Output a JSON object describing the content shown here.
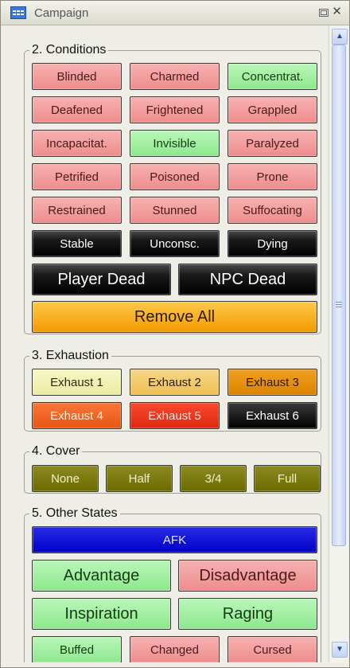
{
  "window": {
    "title": "Campaign",
    "icon": "grid-icon"
  },
  "conditions": {
    "legend": "2. Conditions",
    "buttons": [
      {
        "label": "Blinded",
        "color": "red"
      },
      {
        "label": "Charmed",
        "color": "red"
      },
      {
        "label": "Concentrat.",
        "color": "green"
      },
      {
        "label": "Deafened",
        "color": "red"
      },
      {
        "label": "Frightened",
        "color": "red"
      },
      {
        "label": "Grappled",
        "color": "red"
      },
      {
        "label": "Incapacitat.",
        "color": "red"
      },
      {
        "label": "Invisible",
        "color": "green"
      },
      {
        "label": "Paralyzed",
        "color": "red"
      },
      {
        "label": "Petrified",
        "color": "red"
      },
      {
        "label": "Poisoned",
        "color": "red"
      },
      {
        "label": "Prone",
        "color": "red"
      },
      {
        "label": "Restrained",
        "color": "red"
      },
      {
        "label": "Stunned",
        "color": "red"
      },
      {
        "label": "Suffocating",
        "color": "red"
      },
      {
        "label": "Stable",
        "color": "black"
      },
      {
        "label": "Unconsc.",
        "color": "black"
      },
      {
        "label": "Dying",
        "color": "black"
      }
    ],
    "player_dead": "Player Dead",
    "npc_dead": "NPC Dead",
    "remove_all": "Remove All"
  },
  "exhaustion": {
    "legend": "3. Exhaustion",
    "buttons": [
      "Exhaust 1",
      "Exhaust 2",
      "Exhaust 3",
      "Exhaust 4",
      "Exhaust 5",
      "Exhaust 6"
    ]
  },
  "cover": {
    "legend": "4. Cover",
    "buttons": [
      "None",
      "Half",
      "3/4",
      "Full"
    ]
  },
  "other_states": {
    "legend": "5. Other States",
    "afk": "AFK",
    "advantage": "Advantage",
    "disadvantage": "Disadvantage",
    "inspiration": "Inspiration",
    "raging": "Raging",
    "buffed": "Buffed",
    "changed": "Changed",
    "cursed": "Cursed"
  }
}
